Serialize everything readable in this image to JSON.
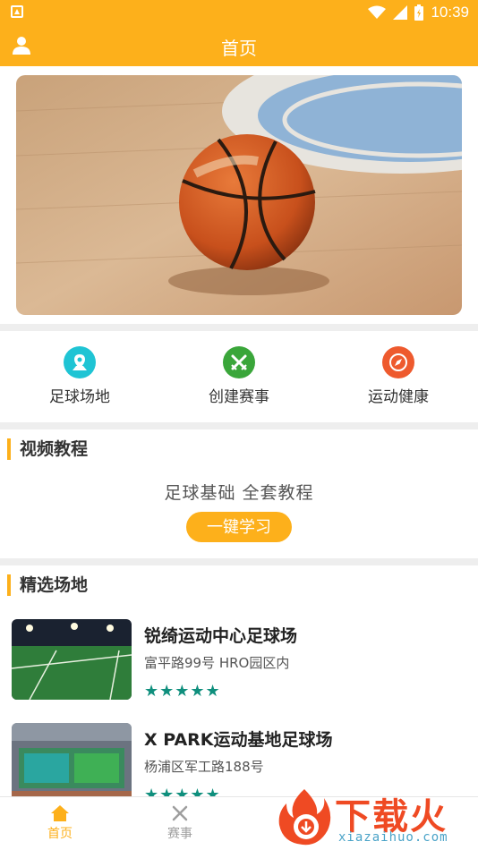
{
  "status_bar": {
    "time": "10:39"
  },
  "app_bar": {
    "title": "首页"
  },
  "quick_actions": [
    {
      "label": "足球场地",
      "icon": "map-pin-icon",
      "color": "#1fc4d4"
    },
    {
      "label": "创建赛事",
      "icon": "crossed-swords-icon",
      "color": "#3aa63a"
    },
    {
      "label": "运动健康",
      "icon": "compass-icon",
      "color": "#ee5a2e"
    }
  ],
  "video_section": {
    "title": "视频教程",
    "subtitle": "足球基础 全套教程",
    "button_label": "一键学习"
  },
  "venues_section": {
    "title": "精选场地",
    "items": [
      {
        "name": "锐绮运动中心足球场",
        "address": "富平路99号 HRO园区内",
        "stars": "★★★★★"
      },
      {
        "name": "X PARK运动基地足球场",
        "address": "杨浦区军工路188号",
        "stars": "★★★★★"
      }
    ]
  },
  "bottom_nav": [
    {
      "label": "首页",
      "icon": "home-icon",
      "active": true
    },
    {
      "label": "赛事",
      "icon": "crossed-swords-icon",
      "active": false
    }
  ],
  "watermark": {
    "text": "下载火",
    "url": "xiazaihuo.com"
  },
  "colors": {
    "accent": "#fdb01b",
    "star": "#0f8f7d",
    "inactive": "#9e9e9e"
  }
}
